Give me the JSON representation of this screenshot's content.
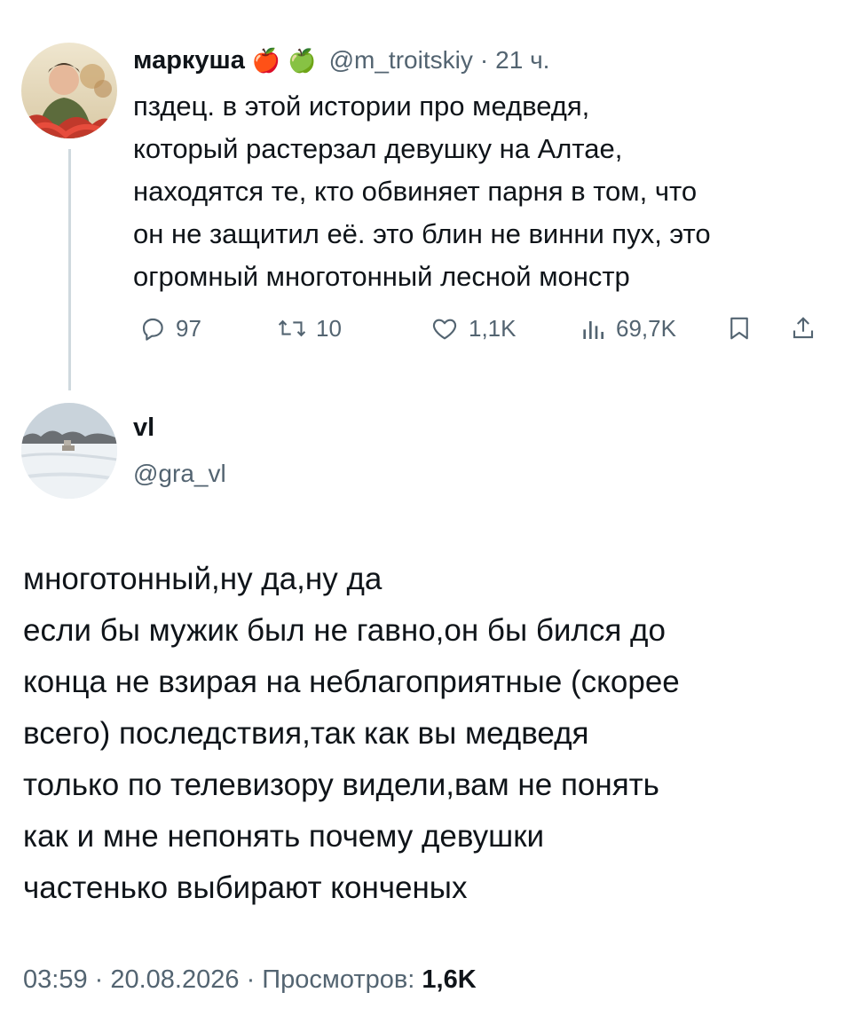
{
  "reply_tweet": {
    "display_name": "маркуша",
    "emoji": [
      "🍎",
      "🍏"
    ],
    "handle": "@m_troitskiy",
    "time": "21 ч.",
    "text": "пздец. в этой истории про медведя,\nкоторый растерзал девушку на Алтае,\nнаходятся те, кто обвиняет парня в том, что\nон не защитил её. это блин не винни пух, это\nогромный многотонный лесной монстр",
    "actions": {
      "replies": "97",
      "reposts": "10",
      "likes": "1,1K",
      "views": "69,7K"
    }
  },
  "main_tweet": {
    "display_name": "vl",
    "handle": "@gra_vl",
    "text": "многотонный,ну да,ну да\nесли бы мужик был не гавно,он бы бился до\nконца не взирая на неблагоприятные (скорее\nвсего) последствия,так как вы медведя\nтолько по телевизору видели,вам не понять\nкак и мне непонять почему девушки\nчастенько выбирают конченых",
    "time": "03:59",
    "date": "20.08.2026",
    "views_label": "Просмотров:",
    "views_count": "1,6K"
  },
  "colors": {
    "text": "#0f1419",
    "muted": "#536471",
    "thread_line": "#cfd9de"
  },
  "icons": [
    "reply-icon",
    "repost-icon",
    "like-icon",
    "views-icon",
    "bookmark-icon",
    "share-icon"
  ]
}
